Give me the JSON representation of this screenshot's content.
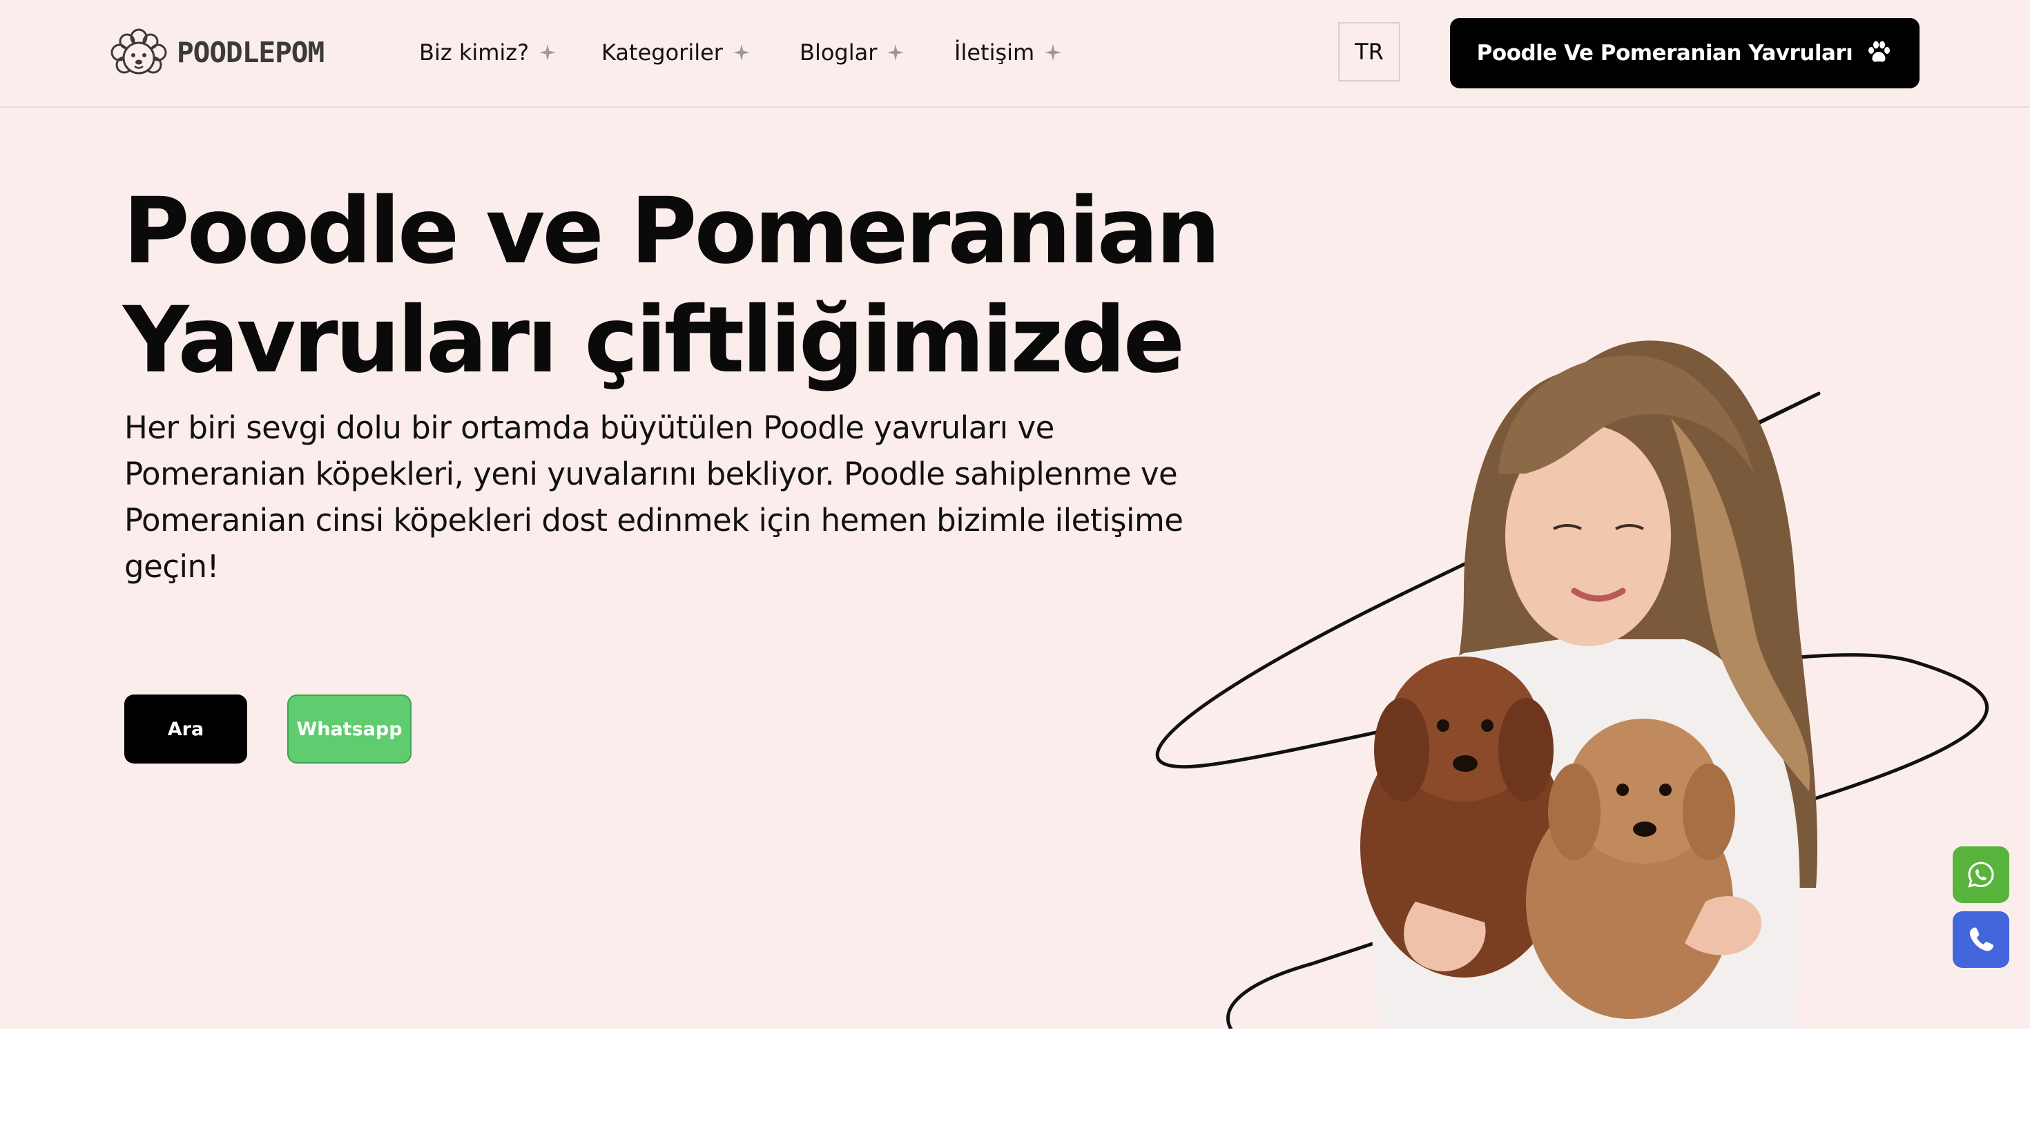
{
  "header": {
    "logo_text": "POODLEPOM",
    "nav": [
      {
        "label": "Biz kimiz?"
      },
      {
        "label": "Kategoriler"
      },
      {
        "label": "Bloglar"
      },
      {
        "label": "İletişim"
      }
    ],
    "language": "TR",
    "cta_label": "Poodle Ve Pomeranian Yavruları",
    "cta_icon": "paw-icon"
  },
  "hero": {
    "title_line1": "Poodle ve Pomeranian",
    "title_line2": "Yavruları çiftliğimizde",
    "subtitle": "Her biri sevgi dolu bir ortamda büyütülen Poodle yavruları ve Pomeranian köpekleri, yeni yuvalarını bekliyor. Poodle sahiplenme ve Pomeranian cinsi köpekleri dost edinmek için hemen bizimle iletişime geçin!",
    "button_call": "Ara",
    "button_whatsapp": "Whatsapp"
  },
  "floating": {
    "whatsapp_icon": "whatsapp-icon",
    "phone_icon": "phone-icon"
  },
  "colors": {
    "hero_bg": "#fbedeb",
    "primary": "#000000",
    "whatsapp_green": "#5fcd6f",
    "float_green": "#58b43c",
    "float_blue": "#4466dc"
  }
}
